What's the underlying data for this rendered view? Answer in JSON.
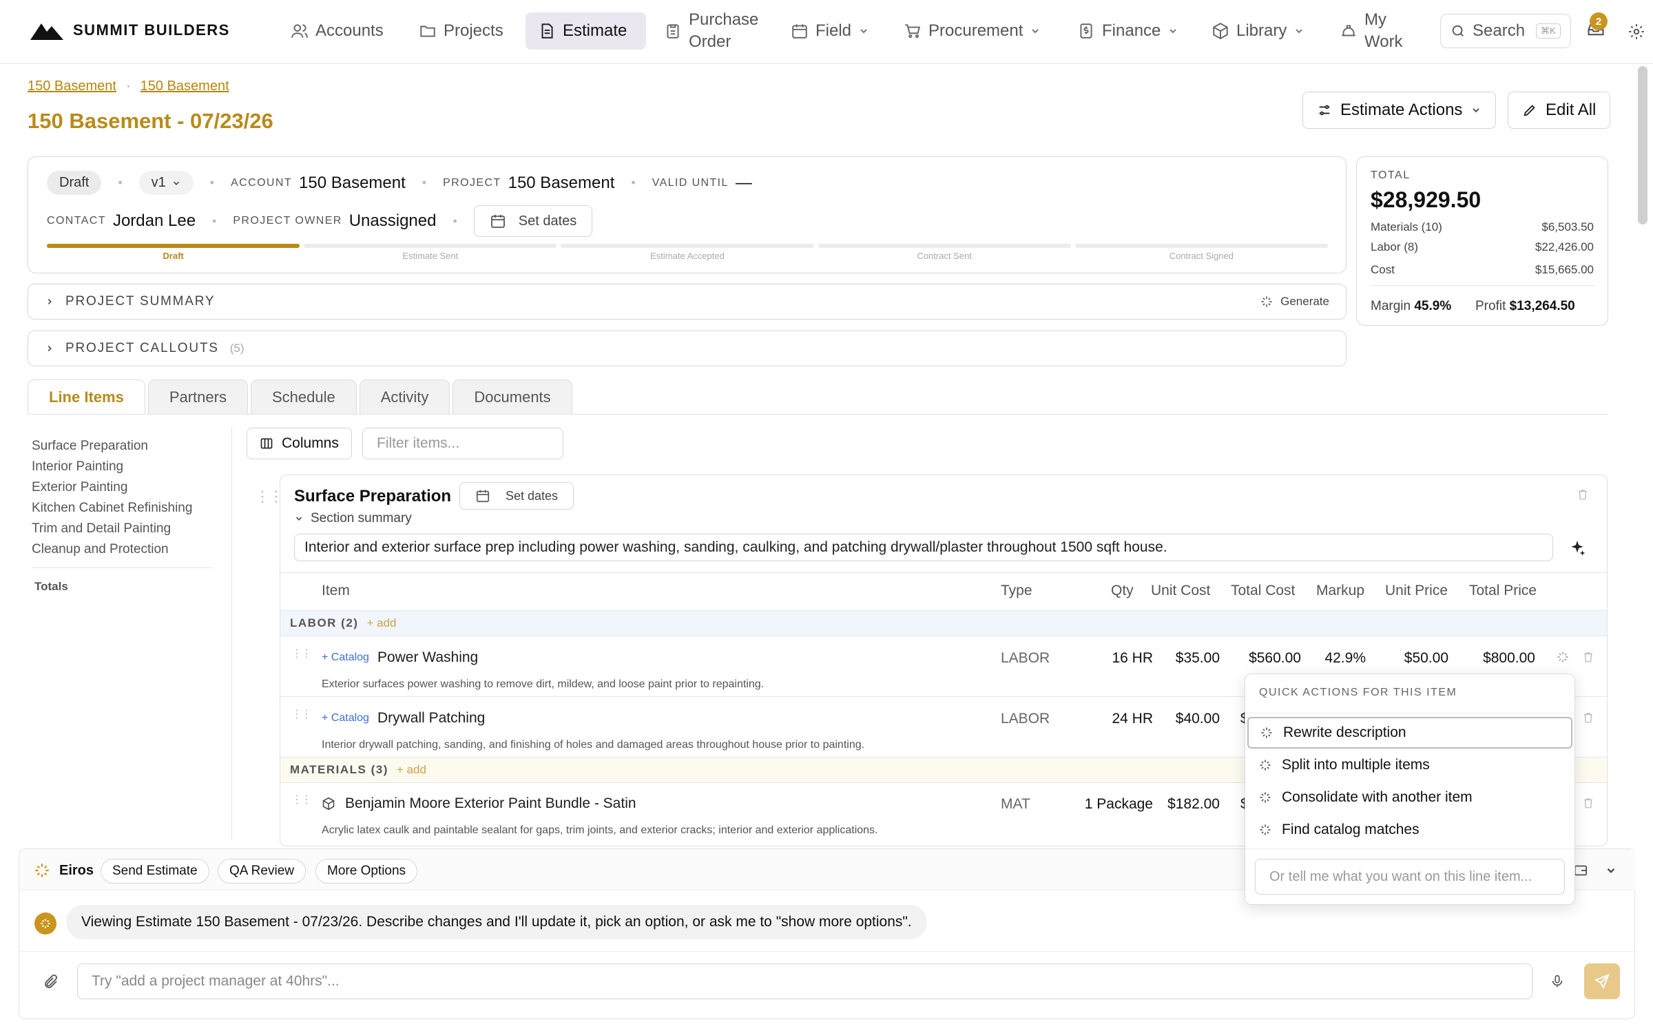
{
  "brand": {
    "name": "SUMMIT BUILDERS"
  },
  "nav": {
    "accounts": "Accounts",
    "projects": "Projects",
    "estimate": "Estimate",
    "purchase_order_1": "Purchase",
    "purchase_order_2": "Order",
    "field": "Field",
    "procurement": "Procurement",
    "finance": "Finance",
    "library": "Library",
    "my_work_1": "My",
    "my_work_2": "Work",
    "search": "Search",
    "search_kbd": "⌘K",
    "inbox_count": "2"
  },
  "breadcrumb": {
    "item1": "150 Basement",
    "item2": "150 Basement",
    "sep": "·"
  },
  "page_title": "150 Basement - 07/23/26",
  "actions": {
    "estimate_actions": "Estimate Actions",
    "edit_all": "Edit All"
  },
  "meta": {
    "status": "Draft",
    "version": "v1",
    "account_label": "ACCOUNT",
    "account": "150 Basement",
    "project_label": "PROJECT",
    "project": "150 Basement",
    "valid_until_label": "VALID UNTIL",
    "valid_until": "—",
    "contact_label": "CONTACT",
    "contact": "Jordan Lee",
    "owner_label": "PROJECT OWNER",
    "owner": "Unassigned",
    "set_dates": "Set dates",
    "dot": "•"
  },
  "stages": [
    {
      "label": "Draft",
      "active": true
    },
    {
      "label": "Estimate Sent",
      "active": false
    },
    {
      "label": "Estimate Accepted",
      "active": false
    },
    {
      "label": "Contract Sent",
      "active": false
    },
    {
      "label": "Contract Signed",
      "active": false
    }
  ],
  "summary": {
    "project_summary": "PROJECT SUMMARY",
    "generate": "Generate",
    "project_callouts": "PROJECT CALLOUTS",
    "callouts_count": "(5)"
  },
  "totals": {
    "label": "TOTAL",
    "total": "$28,929.50",
    "materials_label": "Materials (10)",
    "materials": "$6,503.50",
    "labor_label": "Labor (8)",
    "labor": "$22,426.00",
    "cost_label": "Cost",
    "cost": "$15,665.00",
    "margin_label": "Margin",
    "margin": "45.9%",
    "profit_label": "Profit",
    "profit": "$13,264.50"
  },
  "tabs": [
    "Line Items",
    "Partners",
    "Schedule",
    "Activity",
    "Documents"
  ],
  "sections_nav": [
    "Surface Preparation",
    "Interior Painting",
    "Exterior Painting",
    "Kitchen Cabinet Refinishing",
    "Trim and Detail Painting",
    "Cleanup and Protection"
  ],
  "sections_totals": "Totals",
  "toolbar": {
    "columns": "Columns",
    "filter_placeholder": "Filter items..."
  },
  "section": {
    "title": "Surface Preparation",
    "set_dates": "Set dates",
    "summary_toggle": "Section summary",
    "description": "Interior and exterior surface prep including power washing, sanding, caulking, and patching drywall/plaster throughout 1500 sqft house."
  },
  "table": {
    "headers": {
      "item": "Item",
      "type": "Type",
      "qty": "Qty",
      "unit_cost": "Unit Cost",
      "total_cost": "Total Cost",
      "markup": "Markup",
      "unit_price": "Unit Price",
      "total_price": "Total Price"
    },
    "groups": {
      "labor": "LABOR (2)",
      "materials": "MATERIALS (3)",
      "add": "+ add"
    },
    "catalog": "+ Catalog",
    "rows": [
      {
        "name": "Power Washing",
        "type": "LABOR",
        "qty": "16 HR",
        "unit_cost": "$35.00",
        "total_cost": "$560.00",
        "markup": "42.9%",
        "unit_price": "$50.00",
        "total_price": "$800.00",
        "desc": "Exterior surfaces power washing to remove dirt, mildew, and loose paint prior to repainting."
      },
      {
        "name": "Drywall Patching",
        "type": "LABOR",
        "qty": "24 HR",
        "unit_cost": "$40.00",
        "total_cost": "$",
        "desc": "Interior drywall patching, sanding, and finishing of holes and damaged areas throughout house prior to painting."
      },
      {
        "name": "Benjamin Moore Exterior Paint Bundle - Satin",
        "type": "MAT",
        "qty": "1 Package",
        "unit_cost": "$182.00",
        "total_cost": "$",
        "desc": "Acrylic latex caulk and paintable sealant for gaps, trim joints, and exterior cracks; interior and exterior applications."
      }
    ]
  },
  "quick_actions": {
    "header": "QUICK ACTIONS FOR THIS ITEM",
    "items": [
      "Rewrite description",
      "Split into multiple items",
      "Consolidate with another item",
      "Find catalog matches"
    ],
    "input_placeholder": "Or tell me what you want on this line item..."
  },
  "assistant": {
    "name": "Eiros",
    "chips": [
      "Send Estimate",
      "QA Review",
      "More Options"
    ],
    "message": "Viewing Estimate 150 Basement - 07/23/26. Describe changes and I'll update it, pick an option, or ask me to \"show more options\".",
    "prompt_placeholder": "Try \"add a project manager at 40hrs\"..."
  },
  "colors": {
    "accent": "#b88a1a",
    "badge": "#c9951f",
    "link": "#3b6fd8",
    "send": "#e8c98a"
  }
}
